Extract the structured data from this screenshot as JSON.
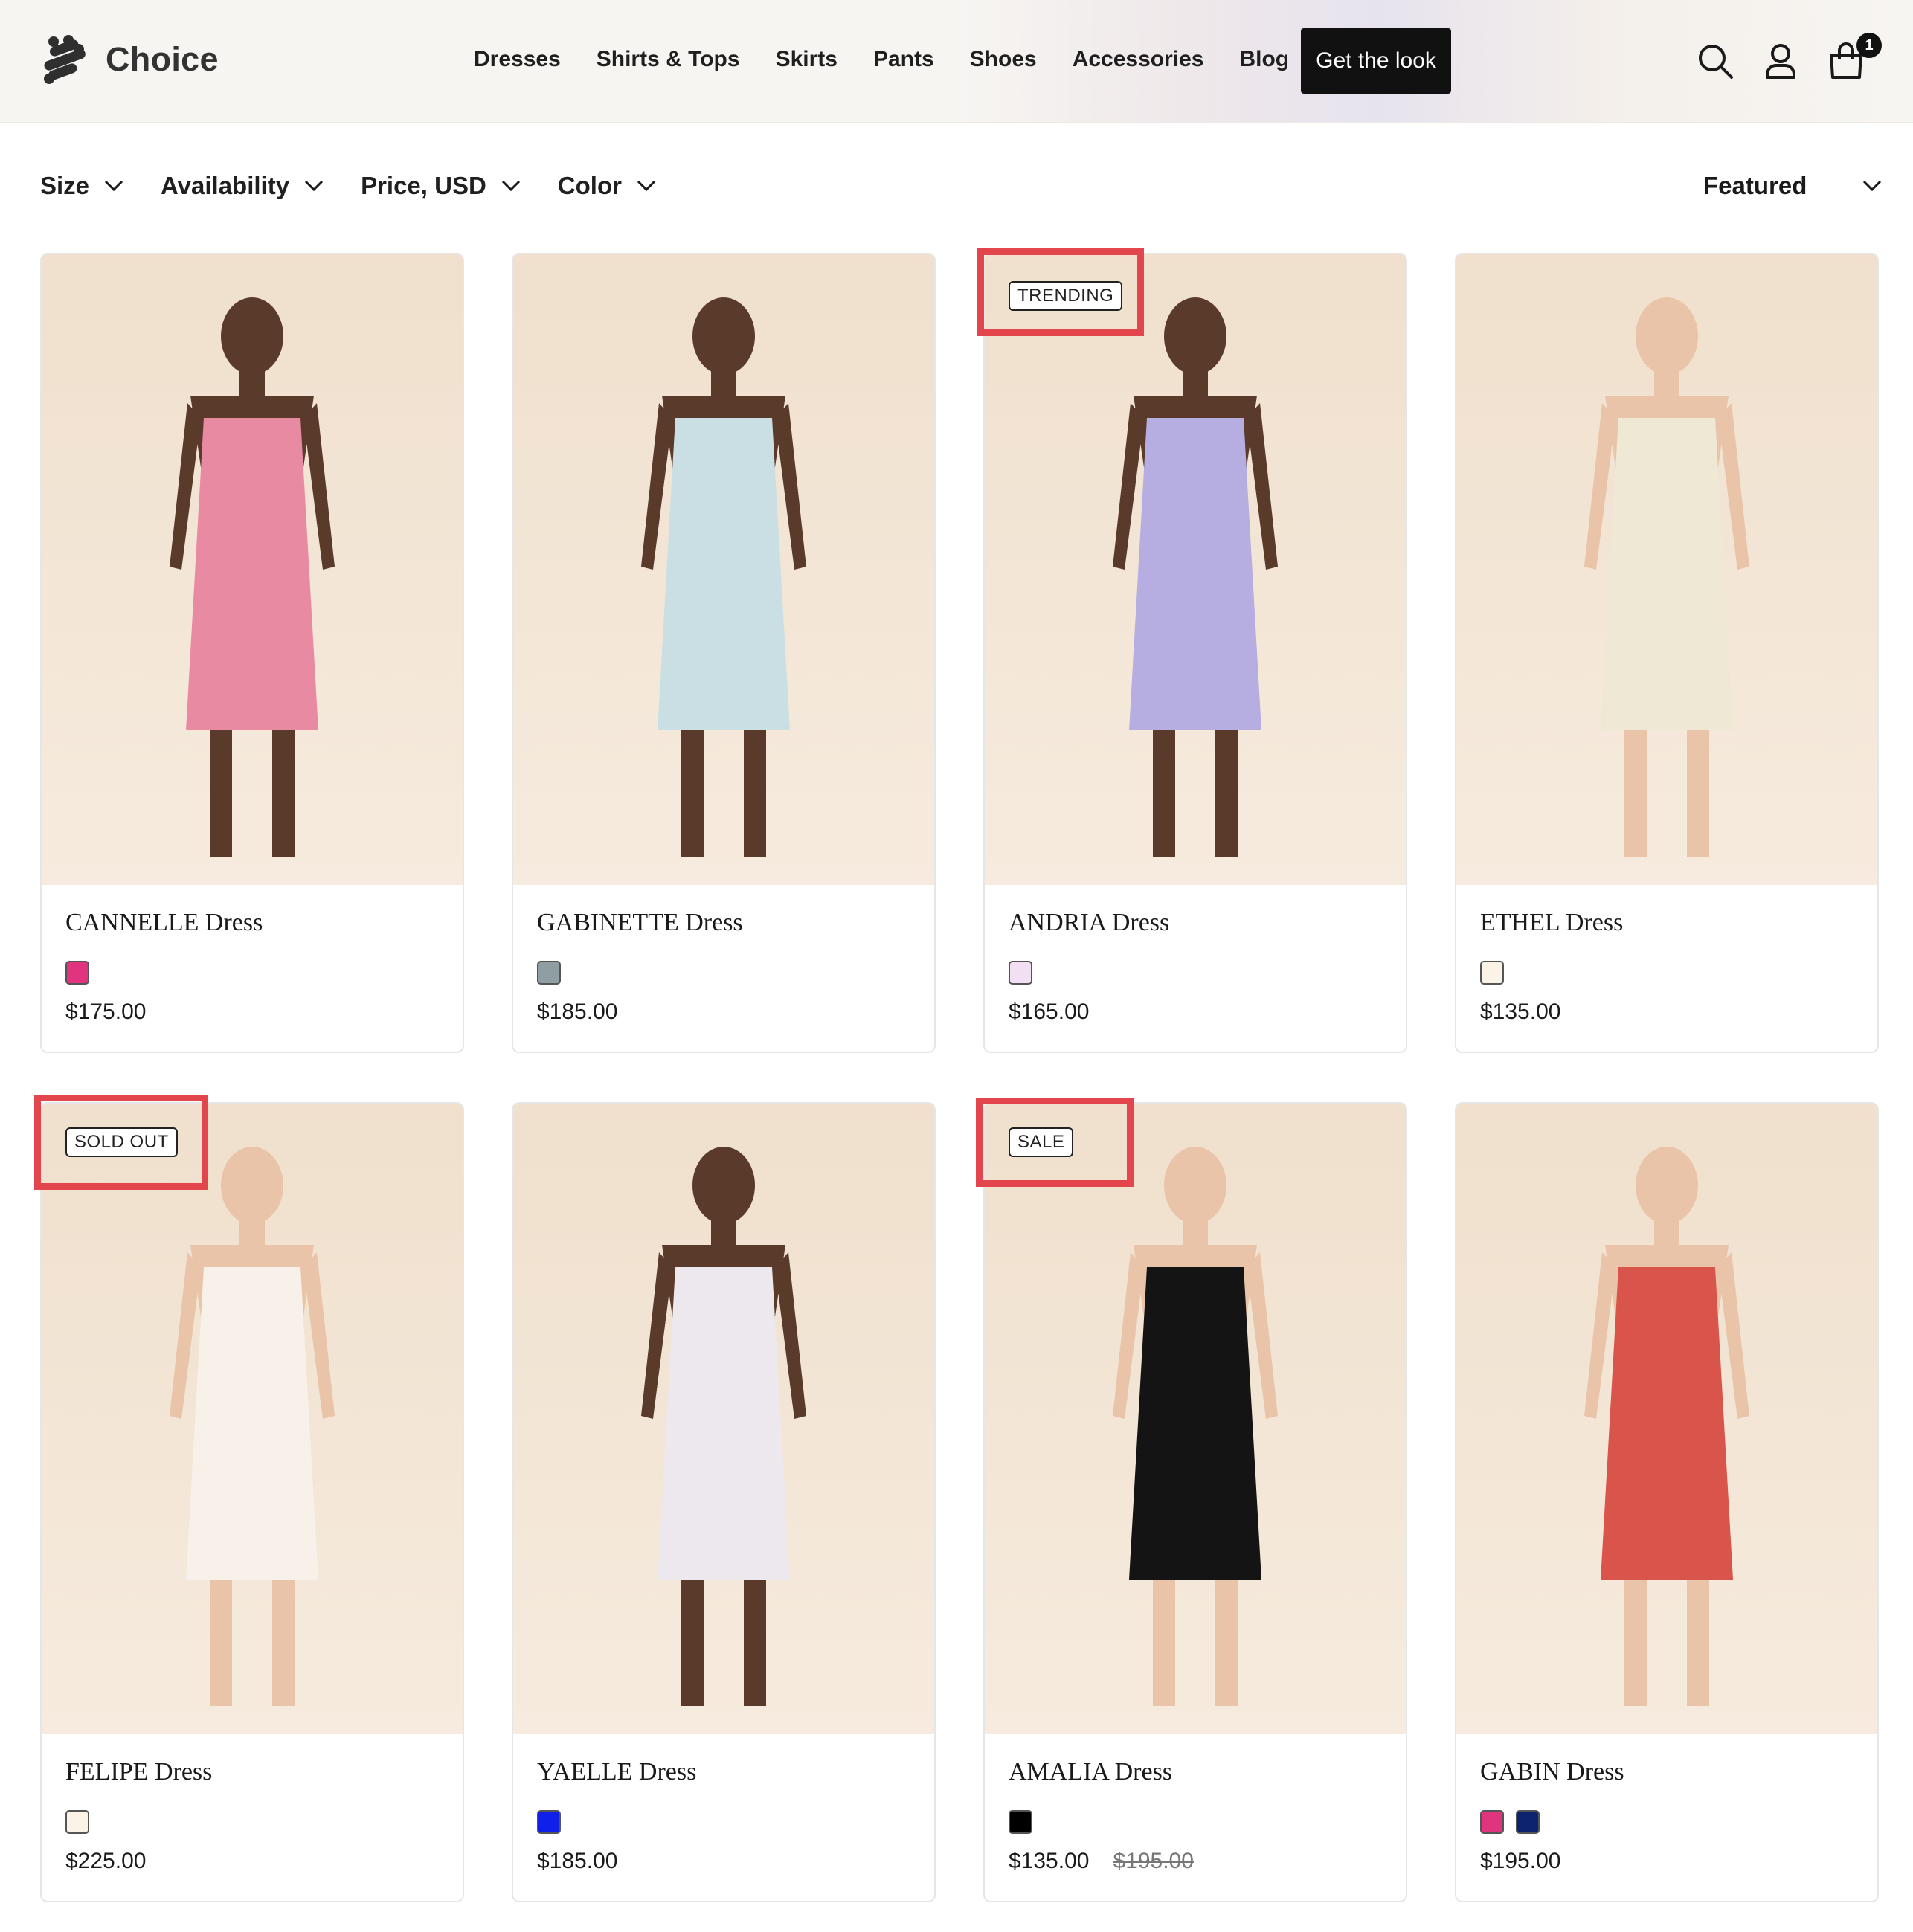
{
  "brand": {
    "name": "Choice"
  },
  "nav": {
    "items": [
      "Dresses",
      "Shirts & Tops",
      "Skirts",
      "Pants",
      "Shoes",
      "Accessories",
      "Blog"
    ],
    "cta_label": "Get the look",
    "cart_count": "1",
    "icons": [
      "search-icon",
      "account-icon",
      "cart-icon"
    ]
  },
  "filters": {
    "items": [
      "Size",
      "Availability",
      "Price, USD",
      "Color"
    ],
    "sort_label": "Featured"
  },
  "products": [
    {
      "name": "CANNELLE Dress",
      "price": "$175.00",
      "swatches": [
        "#e0347f"
      ],
      "badge": "",
      "dress_color": "#e98aa3"
    },
    {
      "name": "GABINETTE Dress",
      "price": "$185.00",
      "swatches": [
        "#8e9ea3"
      ],
      "badge": "",
      "dress_color": "#c9dfe3"
    },
    {
      "name": "ANDRIA Dress",
      "price": "$165.00",
      "swatches": [
        "#f3dff3"
      ],
      "badge": "TRENDING",
      "dress_color": "#b6aee0"
    },
    {
      "name": "ETHEL Dress",
      "price": "$135.00",
      "swatches": [
        "#fbf3e6"
      ],
      "badge": "",
      "dress_color": "#efe8d4"
    },
    {
      "name": "FELIPE Dress",
      "price": "$225.00",
      "swatches": [
        "#fbf3e6"
      ],
      "badge": "SOLD OUT",
      "dress_color": "#f7f1ea"
    },
    {
      "name": "YAELLE Dress",
      "price": "$185.00",
      "swatches": [
        "#1020e8"
      ],
      "badge": "",
      "dress_color": "#ece8ee"
    },
    {
      "name": "AMALIA Dress",
      "price": "$135.00",
      "compare_price": "$195.00",
      "swatches": [
        "#000000"
      ],
      "badge": "SALE",
      "dress_color": "#141414"
    },
    {
      "name": "GABIN Dress",
      "price": "$195.00",
      "swatches": [
        "#e0347f",
        "#0d2370"
      ],
      "badge": "",
      "dress_color": "#d9544a"
    }
  ],
  "colors": {
    "accent": "#111111",
    "highlight": "#e2464c",
    "photo_bg": "#f2e4d3",
    "skin_dark": "#5a3a2a",
    "skin_light": "#e9c4a8"
  }
}
